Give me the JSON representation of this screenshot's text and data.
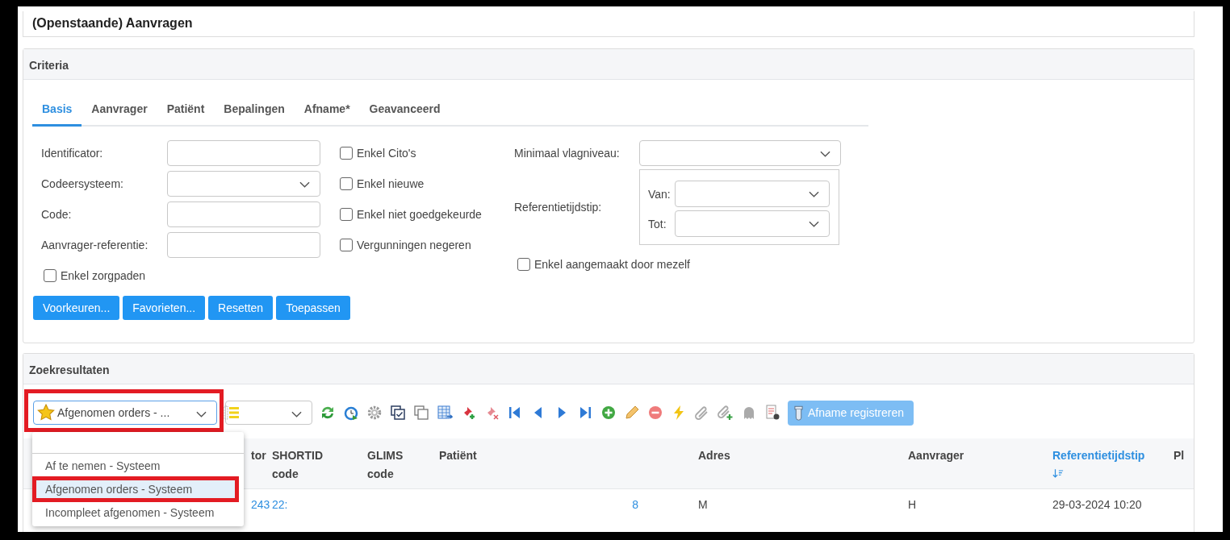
{
  "page_title": "(Openstaande) Aanvragen",
  "criteria": {
    "title": "Criteria",
    "tabs": [
      {
        "label": "Basis",
        "selected": true
      },
      {
        "label": "Aanvrager",
        "selected": false
      },
      {
        "label": "Patiënt",
        "selected": false
      },
      {
        "label": "Bepalingen",
        "selected": false
      },
      {
        "label": "Afname*",
        "selected": false
      },
      {
        "label": "Geavanceerd",
        "selected": false
      }
    ],
    "fields": [
      {
        "label": "Identificator:",
        "kind": "text"
      },
      {
        "label": "Codeersysteem:",
        "kind": "select"
      },
      {
        "label": "Code:",
        "kind": "text"
      },
      {
        "label": "Aanvrager-referentie:",
        "kind": "text"
      }
    ],
    "left_checkbox": {
      "label": "Enkel zorgpaden",
      "checked": false
    },
    "checkboxes": [
      {
        "label": "Enkel Cito's",
        "checked": false
      },
      {
        "label": "Enkel nieuwe",
        "checked": false
      },
      {
        "label": "Enkel niet goedgekeurde",
        "checked": false
      },
      {
        "label": "Vergunningen negeren",
        "checked": false
      }
    ],
    "flag_level": {
      "label": "Minimaal vlagniveau:"
    },
    "reference_time": {
      "label": "Referentietijdstip:",
      "from_label": "Van:",
      "to_label": "Tot:"
    },
    "own_checkbox": {
      "label": "Enkel aangemaakt door mezelf",
      "checked": false
    },
    "buttons": [
      "Voorkeuren...",
      "Favorieten...",
      "Resetten",
      "Toepassen"
    ]
  },
  "results": {
    "title": "Zoekresultaten",
    "view_select": {
      "value": "Afgenomen orders - ...",
      "highlighted": true
    },
    "register_button": {
      "label": "Afname registreren",
      "disabled": true
    },
    "view_options": [
      {
        "label": "Af te nemen - Systeem",
        "selected": false,
        "highlighted": false
      },
      {
        "label": "Afgenomen orders - Systeem",
        "selected": true,
        "highlighted": true
      },
      {
        "label": "Incompleet afgenomen - Systeem",
        "selected": false,
        "highlighted": false
      }
    ],
    "columns": [
      {
        "label": "tor",
        "sorted": false
      },
      {
        "label": "SHORTID code",
        "sorted": false
      },
      {
        "label": "GLIMS code",
        "sorted": false
      },
      {
        "label": "Patiënt",
        "sorted": false
      },
      null,
      {
        "label": "Adres",
        "sorted": false
      },
      {
        "label": "Aanvrager",
        "sorted": false
      },
      {
        "label": "Referentietijdstip",
        "sorted": true
      },
      {
        "label": "Pl",
        "sorted": false
      }
    ],
    "rows": [
      {
        "cells": [
          {
            "text": "243",
            "link": true
          },
          {
            "text": "22:",
            "link": true
          },
          null,
          null,
          {
            "text": "8",
            "link": true
          },
          {
            "text": "M",
            "link": false
          },
          {
            "text": "H",
            "link": false
          },
          {
            "text": "29-03-2024 10:20",
            "link": false
          },
          null
        ]
      }
    ]
  }
}
